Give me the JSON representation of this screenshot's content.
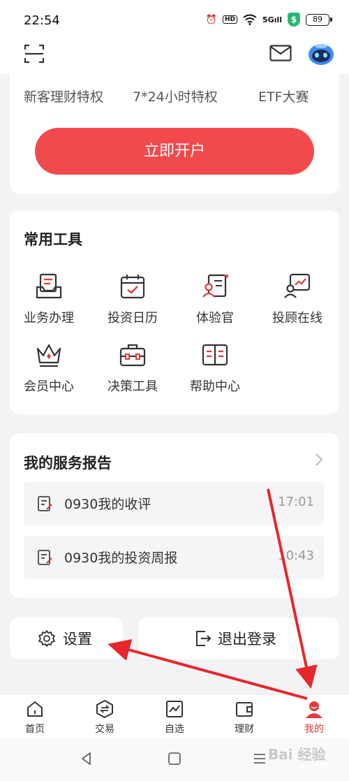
{
  "status_bar": {
    "time": "22:54",
    "network": "5G",
    "hd": "HD",
    "battery": "89"
  },
  "promo": {
    "items": [
      "新客理财特权",
      "7*24小时特权",
      "ETF大赛"
    ],
    "open_button": "立即开户"
  },
  "tools": {
    "title": "常用工具",
    "items": [
      {
        "label": "业务办理",
        "icon": "business-handling-icon"
      },
      {
        "label": "投资日历",
        "icon": "investment-calendar-icon"
      },
      {
        "label": "体验官",
        "icon": "experience-officer-icon"
      },
      {
        "label": "投顾在线",
        "icon": "advisor-online-icon"
      },
      {
        "label": "会员中心",
        "icon": "crown-icon"
      },
      {
        "label": "决策工具",
        "icon": "toolbox-icon"
      },
      {
        "label": "帮助中心",
        "icon": "book-icon"
      }
    ]
  },
  "report": {
    "title": "我的服务报告",
    "rows": [
      {
        "title": "0930我的收评",
        "time": "17:01"
      },
      {
        "title": "0930我的投资周报",
        "time": "10:43"
      }
    ]
  },
  "actions": {
    "settings": "设置",
    "logout": "退出登录"
  },
  "tabbar": {
    "items": [
      {
        "label": "首页",
        "icon": "home-icon"
      },
      {
        "label": "交易",
        "icon": "trade-icon"
      },
      {
        "label": "自选",
        "icon": "watchlist-icon"
      },
      {
        "label": "理财",
        "icon": "wallet-icon"
      },
      {
        "label": "我的",
        "icon": "profile-icon"
      }
    ],
    "active_index": 4
  },
  "watermark": "Bai 经验",
  "colors": {
    "accent": "#f24a4c",
    "annotation_arrow": "#e8262b",
    "background": "#f3f3f5"
  }
}
